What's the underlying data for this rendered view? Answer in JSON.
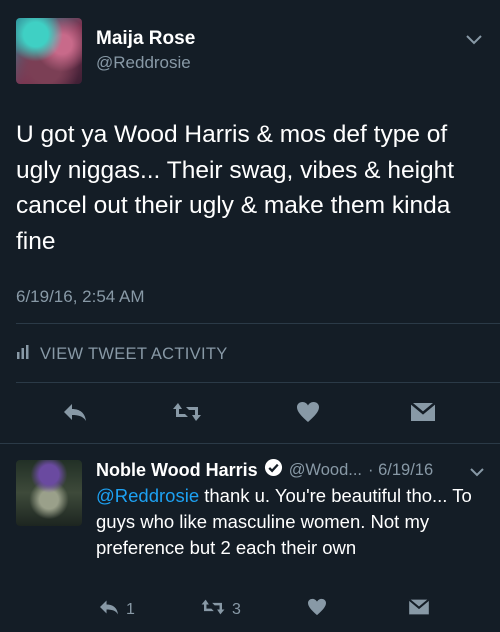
{
  "main_tweet": {
    "author_name": "Maija Rose",
    "author_handle": "@Reddrosie",
    "text": "U got ya Wood Harris & mos def type of ugly niggas... Their swag, vibes & height cancel out their ugly & make them kinda fine",
    "timestamp": "6/19/16, 2:54 AM",
    "activity_label": "VIEW TWEET ACTIVITY",
    "icons": [
      "reply-icon",
      "retweet-icon",
      "like-icon",
      "dm-icon"
    ]
  },
  "reply_tweet": {
    "author_name": "Noble Wood Harris",
    "author_handle": "@Wood...",
    "date": "· 6/19/16",
    "mention": "@Reddrosie",
    "text": " thank u. You're beautiful tho... To guys who like masculine women. Not my preference but 2 each their own",
    "reply_count": "1",
    "retweet_count": "3"
  },
  "colors": {
    "background": "#141d26",
    "secondary_text": "#8899a6",
    "link": "#1da1f2",
    "divider": "#2b3a47"
  }
}
